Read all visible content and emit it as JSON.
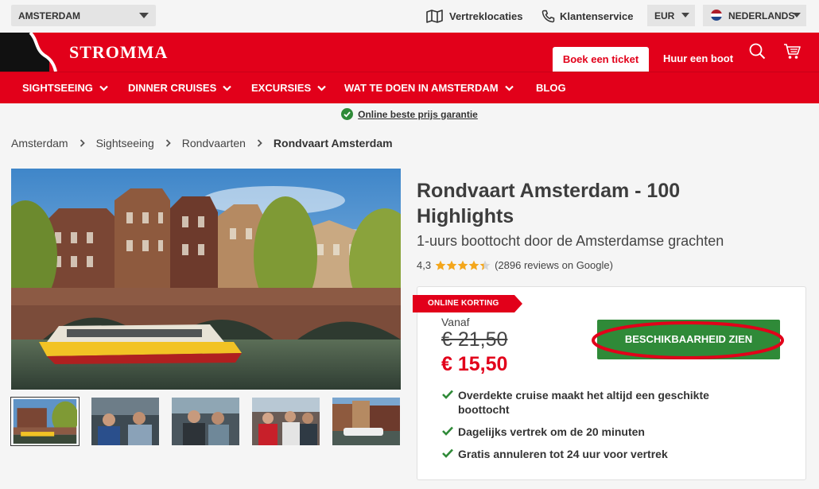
{
  "topbar": {
    "city": "AMSTERDAM",
    "departure_locations": "Vertreklocaties",
    "customer_service": "Klantenservice",
    "currency": "EUR",
    "language": "NEDERLANDS"
  },
  "header": {
    "logo": "STROMMA",
    "book_ticket": "Boek een ticket",
    "rent_boat": "Huur een boot",
    "search_icon": "search-icon",
    "cart_icon": "cart-icon"
  },
  "nav": {
    "items": [
      {
        "label": "SIGHTSEEING"
      },
      {
        "label": "DINNER CRUISES"
      },
      {
        "label": "EXCURSIES"
      },
      {
        "label": "WAT TE DOEN IN AMSTERDAM"
      },
      {
        "label": "BLOG"
      }
    ]
  },
  "guarantee": "Online beste prijs garantie",
  "breadcrumb": [
    "Amsterdam",
    "Sightseeing",
    "Rondvaarten",
    "Rondvaart Amsterdam"
  ],
  "product": {
    "title": "Rondvaart Amsterdam - 100 Highlights",
    "subtitle": "1-uurs boottocht door de Amsterdamse grachten",
    "rating": "4,3",
    "rating_value": 4.3,
    "reviews": "(2896 reviews on Google)",
    "badge": "ONLINE KORTING",
    "from_label": "Vanaf",
    "old_price": "€ 21,50",
    "new_price": "€ 15,50",
    "cta": "BESCHIKBAARHEID ZIEN",
    "features": [
      "Overdekte cruise maakt het altijd een geschikte boottocht",
      "Dagelijks vertrek om de 20 minuten",
      "Gratis annuleren tot 24 uur voor vertrek"
    ]
  },
  "colors": {
    "brand_red": "#e2001a",
    "cta_green": "#2f8a38",
    "star": "#f4a61b"
  }
}
